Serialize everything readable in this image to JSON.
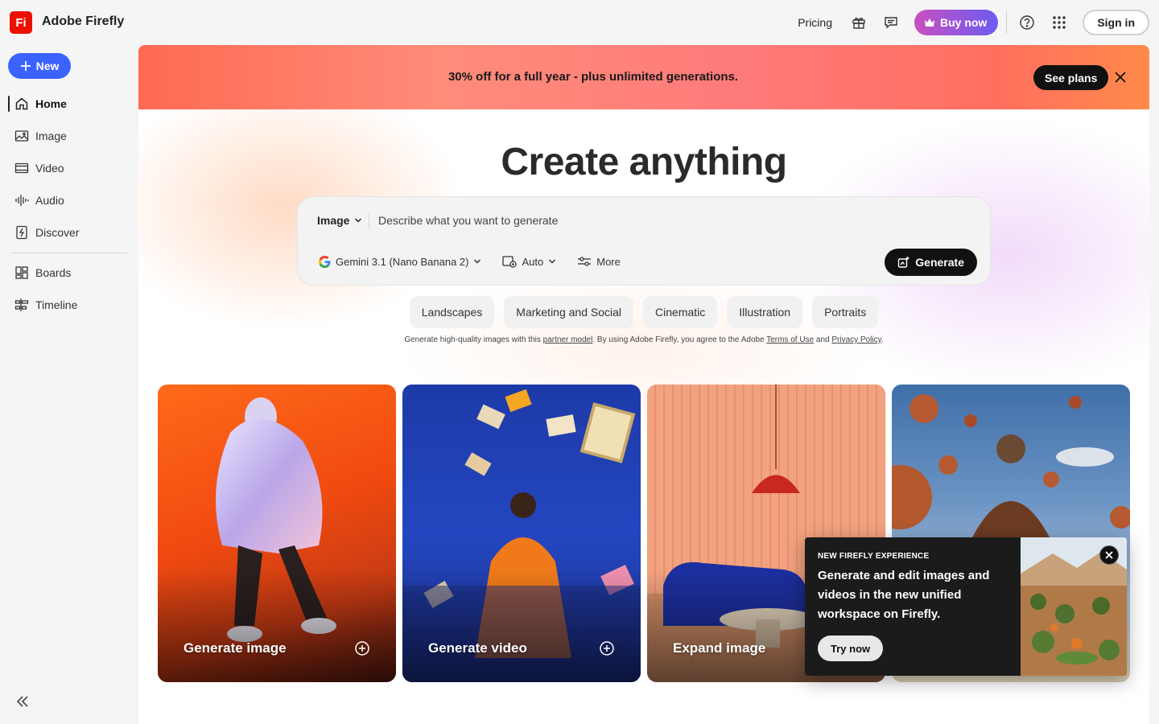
{
  "app": {
    "logo": "Fi",
    "title": "Adobe Firefly"
  },
  "header": {
    "pricing": "Pricing",
    "buy_now": "Buy now",
    "sign_in": "Sign in",
    "icons": [
      "gift-icon",
      "chat-icon",
      "help-icon",
      "apps-grid-icon"
    ]
  },
  "sidebar": {
    "new_label": "New",
    "items": [
      {
        "label": "Home",
        "icon": "home-icon",
        "active": true
      },
      {
        "label": "Image",
        "icon": "image-icon"
      },
      {
        "label": "Video",
        "icon": "video-icon"
      },
      {
        "label": "Audio",
        "icon": "audio-icon"
      },
      {
        "label": "Discover",
        "icon": "discover-icon"
      },
      {
        "label": "Boards",
        "icon": "boards-icon"
      },
      {
        "label": "Timeline",
        "icon": "timeline-icon"
      }
    ]
  },
  "promo": {
    "text": "30% off for a full year  - plus unlimited generations.",
    "cta": "See plans"
  },
  "hero": {
    "title": "Create anything"
  },
  "prompt": {
    "type": "Image",
    "placeholder": "Describe what you want to generate",
    "model": "Gemini 3.1 (Nano Banana 2)",
    "aspect": "Auto",
    "more": "More",
    "generate": "Generate"
  },
  "chips": [
    "Landscapes",
    "Marketing and Social",
    "Cinematic",
    "Illustration",
    "Portraits"
  ],
  "disclaimer": {
    "part1": "Generate high-quality images with this ",
    "link1": "partner model",
    "part2": ". By using Adobe Firefly, you agree to the Adobe ",
    "link2": "Terms of Use",
    "part3": " and ",
    "link3": "Privacy Policy",
    "part4": "."
  },
  "cards": [
    {
      "label": "Generate image"
    },
    {
      "label": "Generate video"
    },
    {
      "label": "Expand image"
    },
    {
      "label": ""
    }
  ],
  "popover": {
    "eyebrow": "NEW FIREFLY EXPERIENCE",
    "text": "Generate and edit images and videos in the new unified workspace on Firefly.",
    "cta": "Try now"
  },
  "colors": {
    "brand_red": "#eb1000",
    "accent_blue": "#3b63fb",
    "buy_gradient_start": "#c850c0",
    "buy_gradient_end": "#6b5cf0"
  }
}
